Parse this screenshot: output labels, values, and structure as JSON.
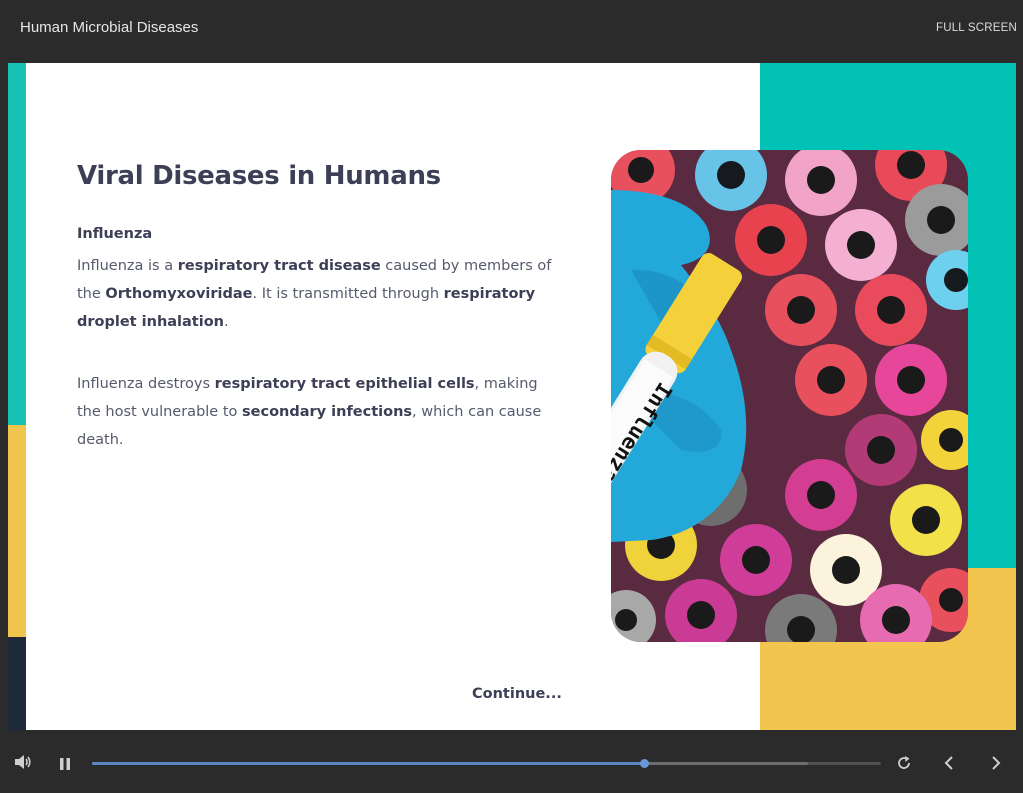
{
  "header": {
    "course_title": "Human Microbial Diseases",
    "fullscreen_label": "FULL SCREEN"
  },
  "slide": {
    "heading": "Viral Diseases in Humans",
    "subheading": "Influenza",
    "paragraph1": {
      "t1": "Influenza is a ",
      "b1": "respiratory tract disease",
      "t2": " caused by members of the ",
      "b2": "Orthomyxoviridae",
      "t3": ". It is transmitted through ",
      "b3": "respiratory droplet inhalation",
      "t4": "."
    },
    "paragraph2": {
      "t1": "Influenza destroys ",
      "b1": "respiratory tract epithelial cells",
      "t2": ", making the host vulnerable to ",
      "b2": "secondary infections",
      "t3": ", which can cause death."
    },
    "continue_label": "Continue...",
    "image": {
      "tube_label": "Influenza:",
      "minus": "-",
      "plus": "+"
    }
  },
  "player": {
    "progress_fraction": 0.7,
    "buffered_fraction": 0.907,
    "icons": [
      "volume-icon",
      "pause-icon",
      "replay-icon",
      "previous-icon",
      "next-icon"
    ]
  },
  "colors": {
    "teal": "#02c1b5",
    "yellow": "#f2c54f",
    "navy": "#1f2b3b",
    "text_dark": "#3c3f55",
    "progress": "#5b86c5"
  }
}
